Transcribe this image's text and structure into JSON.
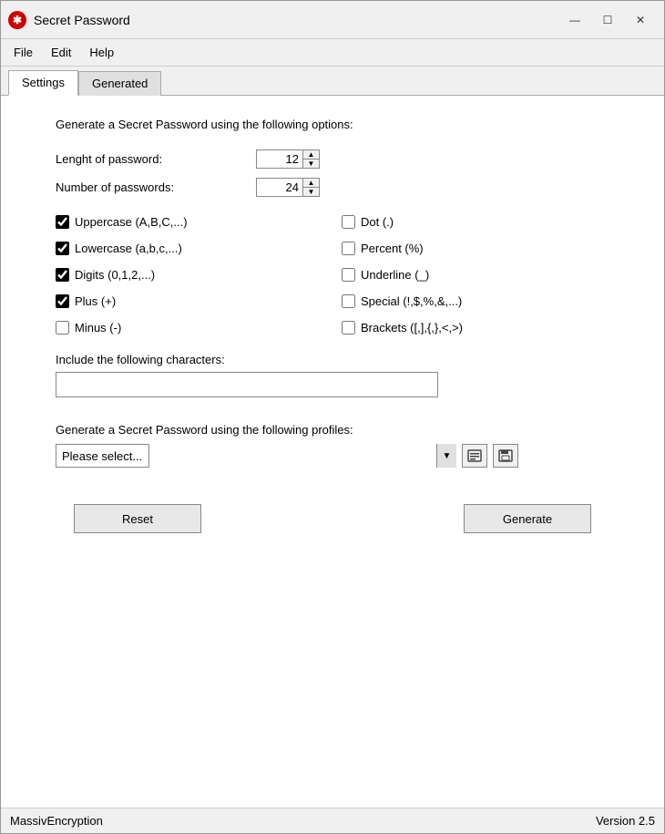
{
  "window": {
    "title": "Secret Password",
    "icon_color": "#cc0000"
  },
  "title_bar": {
    "minimize": "—",
    "maximize": "☐",
    "close": "✕"
  },
  "menu": {
    "items": [
      "File",
      "Edit",
      "Help"
    ]
  },
  "tabs": [
    {
      "label": "Settings",
      "active": true
    },
    {
      "label": "Generated",
      "active": false
    }
  ],
  "settings": {
    "header": "Generate a Secret Password using the following options:",
    "length_label": "Lenght of password:",
    "length_value": "12",
    "count_label": "Number of passwords:",
    "count_value": "24",
    "checkboxes": [
      {
        "label": "Uppercase (A,B,C,...)",
        "checked": true,
        "col": 0
      },
      {
        "label": "Dot (.)",
        "checked": false,
        "col": 1
      },
      {
        "label": "Lowercase (a,b,c,...)",
        "checked": true,
        "col": 0
      },
      {
        "label": "Percent (%)",
        "checked": false,
        "col": 1
      },
      {
        "label": "Digits (0,1,2,...)",
        "checked": true,
        "col": 0
      },
      {
        "label": "Underline (_)",
        "checked": false,
        "col": 1
      },
      {
        "label": "Plus (+)",
        "checked": true,
        "col": 0
      },
      {
        "label": "Special (!,$,%,&,...)",
        "checked": false,
        "col": 1
      },
      {
        "label": "Minus (-)",
        "checked": false,
        "col": 0
      },
      {
        "label": "Brackets ([,],{,},<,>)",
        "checked": false,
        "col": 1
      }
    ],
    "include_label": "Include the following characters:",
    "include_value": "",
    "include_placeholder": "",
    "profiles_header": "Generate a Secret Password using the following profiles:",
    "profiles_placeholder": "Please select...",
    "reset_label": "Reset",
    "generate_label": "Generate"
  },
  "status_bar": {
    "left": "MassivEncryption",
    "right": "Version 2.5"
  }
}
